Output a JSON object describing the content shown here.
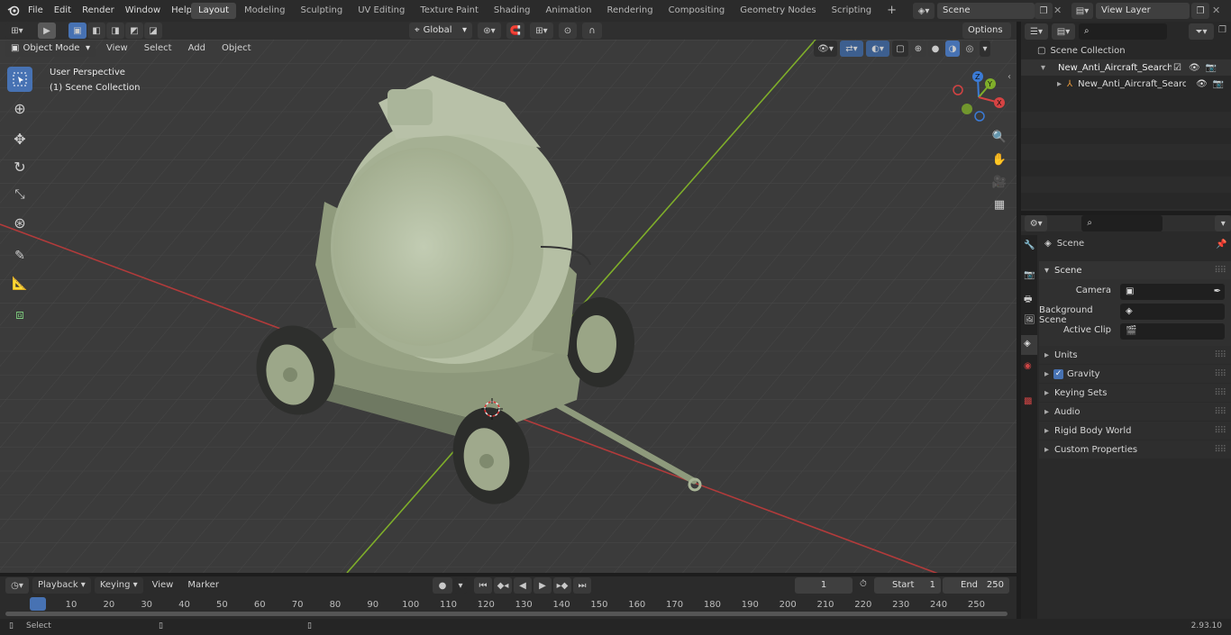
{
  "menu": {
    "items": [
      "File",
      "Edit",
      "Render",
      "Window",
      "Help"
    ],
    "workspaces": [
      "Layout",
      "Modeling",
      "Sculpting",
      "UV Editing",
      "Texture Paint",
      "Shading",
      "Animation",
      "Rendering",
      "Compositing",
      "Geometry Nodes",
      "Scripting"
    ],
    "active_workspace": "Layout",
    "scene_name": "Scene",
    "view_layer": "View Layer"
  },
  "viewport": {
    "mode": "Object Mode",
    "menus": [
      "View",
      "Select",
      "Add",
      "Object"
    ],
    "transform_orientation": "Global",
    "options_label": "Options",
    "overlay_line1": "User Perspective",
    "overlay_line2": "(1) Scene Collection",
    "axis_labels": {
      "z": "Z",
      "y": "Y",
      "x": "X"
    }
  },
  "outliner": {
    "root": "Scene Collection",
    "items": [
      {
        "label": "New_Anti_Aircraft_Searchligh",
        "level": 1
      },
      {
        "label": "New_Anti_Aircraft_Searcl",
        "level": 2
      }
    ]
  },
  "properties": {
    "header": "Scene",
    "section": "Scene",
    "fields": [
      {
        "label": "Camera",
        "value": ""
      },
      {
        "label": "Background Scene",
        "value": ""
      },
      {
        "label": "Active Clip",
        "value": ""
      }
    ],
    "panels": [
      "Units",
      "Gravity",
      "Keying Sets",
      "Audio",
      "Rigid Body World",
      "Custom Properties"
    ],
    "gravity_checked": true
  },
  "timeline": {
    "menus": [
      "Playback",
      "Keying",
      "View",
      "Marker"
    ],
    "current_frame": "1",
    "start_label": "Start",
    "start_value": "1",
    "end_label": "End",
    "end_value": "250",
    "ticks": [
      "1",
      "10",
      "20",
      "30",
      "40",
      "50",
      "60",
      "70",
      "80",
      "90",
      "100",
      "110",
      "120",
      "130",
      "140",
      "150",
      "160",
      "170",
      "180",
      "190",
      "200",
      "210",
      "220",
      "230",
      "240",
      "250"
    ]
  },
  "status": {
    "left": "Select",
    "version": "2.93.10"
  },
  "colors": {
    "accent": "#4772b3",
    "x_axis": "#b23b3b",
    "y_axis": "#7fae2a",
    "model": "#a9b597"
  }
}
